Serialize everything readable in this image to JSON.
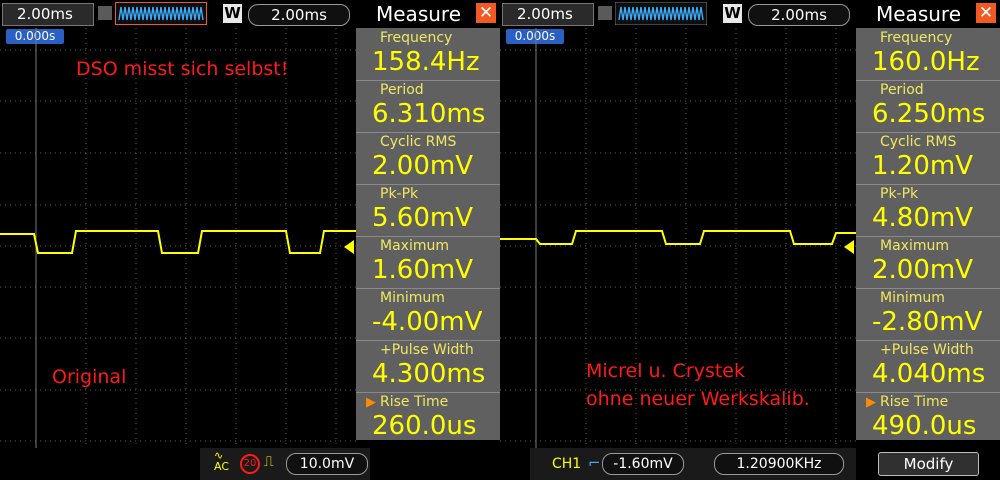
{
  "left": {
    "timebase": "2.00ms",
    "trigger_delay": "2.00ms",
    "trigger_badge": "0.000s",
    "measure_title": "Measure",
    "annotations": {
      "top": "DSO misst sich selbst!",
      "bottom": "Original"
    },
    "measurements": [
      {
        "label": "Frequency",
        "value": "158.4Hz"
      },
      {
        "label": "Period",
        "value": "6.310ms"
      },
      {
        "label": "Cyclic RMS",
        "value": "2.00mV"
      },
      {
        "label": "Pk-Pk",
        "value": "5.60mV"
      },
      {
        "label": "Maximum",
        "value": "1.60mV"
      },
      {
        "label": "Minimum",
        "value": "-4.00mV"
      },
      {
        "label": "+Pulse Width",
        "value": "4.300ms"
      },
      {
        "label": "Rise Time",
        "value": "260.0us"
      }
    ]
  },
  "right": {
    "timebase": "2.00ms",
    "trigger_delay": "2.00ms",
    "trigger_badge": "0.000s",
    "measure_title": "Measure",
    "annotations": {
      "line1": "Micrel u. Crystek",
      "line2": "ohne neuer Werkskalib."
    },
    "measurements": [
      {
        "label": "Frequency",
        "value": "160.0Hz"
      },
      {
        "label": "Period",
        "value": "6.250ms"
      },
      {
        "label": "Cyclic RMS",
        "value": "1.20mV"
      },
      {
        "label": "Pk-Pk",
        "value": "4.80mV"
      },
      {
        "label": "Maximum",
        "value": "2.00mV"
      },
      {
        "label": "Minimum",
        "value": "-2.80mV"
      },
      {
        "label": "+Pulse Width",
        "value": "4.040ms"
      },
      {
        "label": "Rise Time",
        "value": "490.0us"
      }
    ]
  },
  "status": {
    "coupling": "AC",
    "bw_limit": "20",
    "ch1_scale": "10.0mV",
    "channel": "CH1",
    "trigger_level": "-1.60mV",
    "trigger_freq": "1.20900KHz",
    "modify_label": "Modify"
  },
  "colors": {
    "trace": "#ffff00",
    "grid": "#5a5a5a",
    "panel": "#606060",
    "accent": "#f15a22",
    "note": "#ff1a1a"
  },
  "icons": [
    "close-icon",
    "waveform-icon",
    "w-icon",
    "trigger-edge-icon",
    "ac-coupling-icon",
    "bandwidth-limit-icon",
    "pulse-icon"
  ]
}
